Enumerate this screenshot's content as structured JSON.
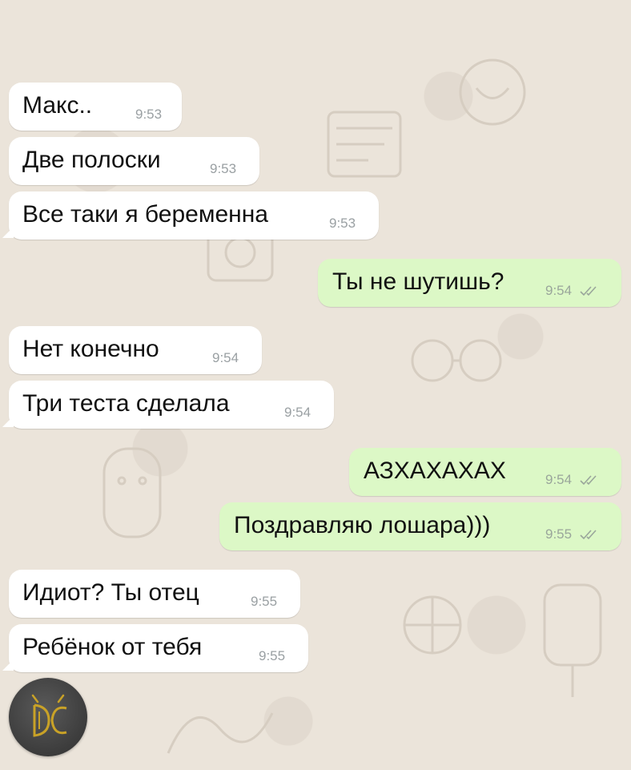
{
  "chat": {
    "messages": [
      {
        "direction": "in",
        "text": "Макс..",
        "time": "9:53"
      },
      {
        "direction": "in",
        "text": "Две полоски",
        "time": "9:53"
      },
      {
        "direction": "in",
        "text": "Все таки я беременна",
        "time": "9:53"
      },
      {
        "direction": "out",
        "text": "Ты не шутишь?",
        "time": "9:54",
        "status": "read-ticks-icon"
      },
      {
        "direction": "in",
        "text": "Нет конечно",
        "time": "9:54"
      },
      {
        "direction": "in",
        "text": "Три теста сделала",
        "time": "9:54"
      },
      {
        "direction": "out",
        "text": "АЗХАХАХАХ",
        "time": "9:54",
        "status": "read-ticks-icon"
      },
      {
        "direction": "out",
        "text": "Поздравляю лошара)))",
        "time": "9:55",
        "status": "read-ticks-icon"
      },
      {
        "direction": "in",
        "text": "Идиот? Ты отец",
        "time": "9:55"
      },
      {
        "direction": "in",
        "text": "Ребёнок от тебя",
        "time": "9:55"
      }
    ]
  },
  "colors": {
    "incoming_bubble": "#ffffff",
    "outgoing_bubble": "#dcf8c6",
    "wallpaper": "#ebe4da",
    "timestamp": "#9aa0a3",
    "logo_gold": "#c9a227"
  },
  "watermark": {
    "icon": "dc-logo-icon",
    "letters": "DC"
  }
}
